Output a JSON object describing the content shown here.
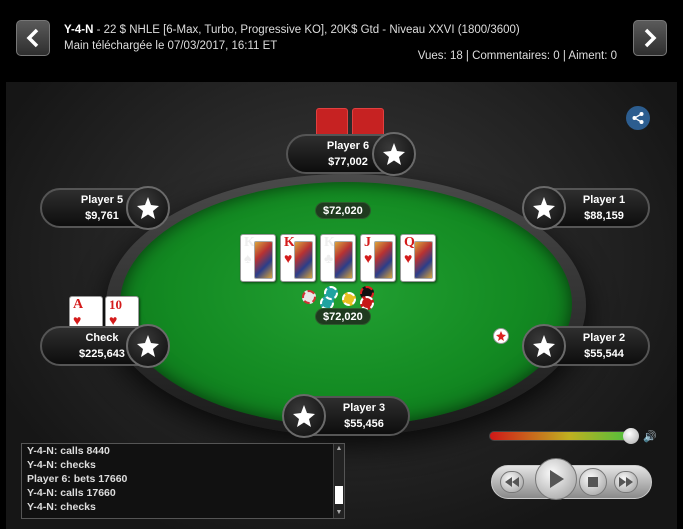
{
  "header": {
    "hero": "Y-4-N",
    "title_rest": " - 22 $ NHLE [6-Max, Turbo, Progressive KO], 20K$ Gtd - Niveau XXVI (1800/3600)",
    "downloaded": "Main téléchargée le 07/03/2017, 16:11 ET",
    "stats": "Vues: 18 | Commentaires: 0 | Aiment: 0"
  },
  "pots": {
    "top": "$72,020",
    "bottom": "$72,020"
  },
  "board": [
    {
      "rank": "K",
      "suit": "♠",
      "color": "black"
    },
    {
      "rank": "K",
      "suit": "♥",
      "color": "red"
    },
    {
      "rank": "K",
      "suit": "♣",
      "color": "black"
    },
    {
      "rank": "J",
      "suit": "♥",
      "color": "red"
    },
    {
      "rank": "Q",
      "suit": "♥",
      "color": "red"
    }
  ],
  "hero_cards": [
    {
      "rank": "A",
      "suit": "♥",
      "color": "red"
    },
    {
      "rank": "10",
      "suit": "♥",
      "color": "red"
    }
  ],
  "seats": {
    "p6": {
      "name": "Player 6",
      "stack": "$77,002"
    },
    "p5": {
      "name": "Player 5",
      "stack": "$9,761"
    },
    "p1": {
      "name": "Player 1",
      "stack": "$88,159"
    },
    "hero": {
      "name": "Check",
      "stack": "$225,643"
    },
    "p2": {
      "name": "Player 2",
      "stack": "$55,544"
    },
    "p3": {
      "name": "Player 3",
      "stack": "$55,456"
    }
  },
  "log": [
    "Y-4-N: calls 8440",
    "Y-4-N: checks",
    "Player 6: bets 17660",
    "Y-4-N: calls 17660",
    "Y-4-N: checks"
  ],
  "colors": {
    "felt": "#138a22",
    "accent_blue": "#2c5d8f",
    "card_back": "#c62222"
  }
}
